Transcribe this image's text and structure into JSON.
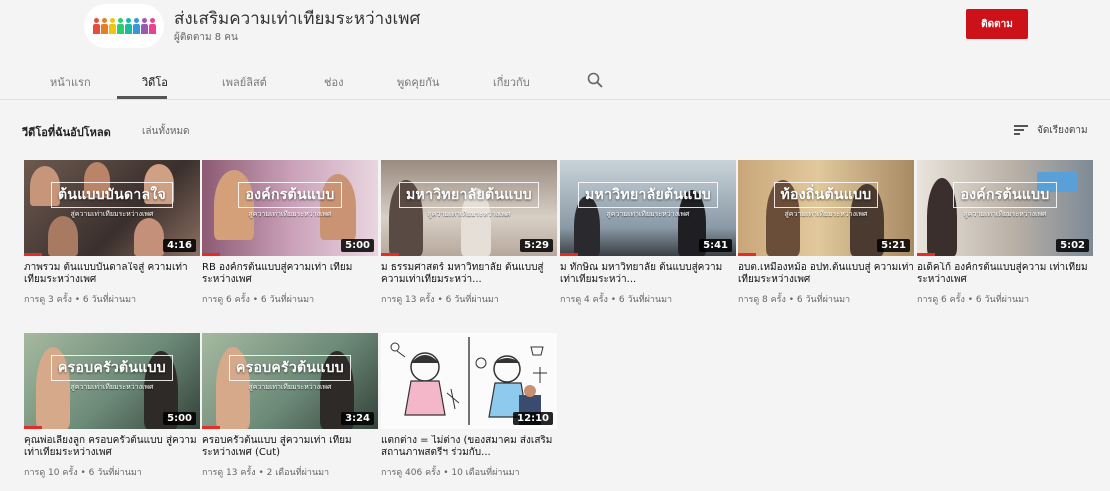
{
  "channel": {
    "name": "ส่งเสริมความเท่าเทียมระหว่างเพศ",
    "subscribers": "ผู้ติดตาม 8 คน",
    "subscribe_label": "ติดตาม",
    "logo_colors": [
      "#e74c3c",
      "#e67e22",
      "#f1c40f",
      "#2ecc71",
      "#1abc9c",
      "#3498db",
      "#9b59b6",
      "#e84393"
    ]
  },
  "tabs": [
    {
      "label": "หน้าแรก",
      "active": false
    },
    {
      "label": "วิดีโอ",
      "active": true
    },
    {
      "label": "เพลย์ลิสต์",
      "active": false
    },
    {
      "label": "ช่อง",
      "active": false
    },
    {
      "label": "พูดคุยกัน",
      "active": false
    },
    {
      "label": "เกี่ยวกับ",
      "active": false
    }
  ],
  "section": {
    "title": "วีดีโอที่ฉันอัปโหลด",
    "play_all": "เล่นทั้งหมด",
    "sort_label": "จัดเรียงตาม"
  },
  "videos": [
    {
      "title": "ภาพรวม ต้นแบบบันดาลใจสู่ ความเท่าเทียมระหว่างเพศ",
      "meta": "การดู 3 ครั้ง • 6 วันที่ผ่านมา",
      "duration": "4:16",
      "overlay": "ต้นแบบบันดาลใจ",
      "overlay_sub": "สู่ความเท่าเทียมระหว่างเพศ"
    },
    {
      "title": "RB องค์กรต้นแบบสู่ความเท่า เทียมระหว่างเพศ",
      "meta": "การดู 6 ครั้ง • 6 วันที่ผ่านมา",
      "duration": "5:00",
      "overlay": "องค์กรต้นแบบ",
      "overlay_sub": "สู่ความเท่าเทียมระหว่างเพศ"
    },
    {
      "title": "ม ธรรมศาสตร์ มหาวิทยาลัย ต้นแบบสู่ความเท่าเทียมระหว่า...",
      "meta": "การดู 13 ครั้ง • 6 วันที่ผ่านมา",
      "duration": "5:29",
      "overlay": "มหาวิทยาลัยต้นแบบ",
      "overlay_sub": "สู่ความเท่าเทียมระหว่างเพศ"
    },
    {
      "title": "ม ทักษิณ มหาวิทยาลัย ต้นแบบสู่ความเท่าเทียมระหว่า...",
      "meta": "การดู 4 ครั้ง • 6 วันที่ผ่านมา",
      "duration": "5:41",
      "overlay": "มหาวิทยาลัยต้นแบบ",
      "overlay_sub": "สู่ความเท่าเทียมระหว่างเพศ"
    },
    {
      "title": "อบต.เหมืองหม้อ อปท.ต้นแบบสู่ ความเท่าเทียมระหว่างเพศ",
      "meta": "การดู 8 ครั้ง • 6 วันที่ผ่านมา",
      "duration": "5:21",
      "overlay": "ท้องถิ่นต้นแบบ",
      "overlay_sub": "สู่ความเท่าเทียมระหว่างเพศ"
    },
    {
      "title": "อเด็คโก้ องค์กรต้นแบบสู่ความ เท่าเทียมระหว่างเพศ",
      "meta": "การดู 6 ครั้ง • 6 วันที่ผ่านมา",
      "duration": "5:02",
      "overlay": "องค์กรต้นแบบ",
      "overlay_sub": "สู่ความเท่าเทียมระหว่างเพศ"
    },
    {
      "title": "คุณพ่อเลี้ยงลูก ครอบครัวต้นแบบ สู่ความเท่าเทียมระหว่างเพศ",
      "meta": "การดู 10 ครั้ง • 6 วันที่ผ่านมา",
      "duration": "5:00",
      "overlay": "ครอบครัวต้นแบบ",
      "overlay_sub": "สู่ความเท่าเทียมระหว่างเพศ"
    },
    {
      "title": "ครอบครัวต้นแบบ สู่ความเท่า เทียมระหว่างเพศ (Cut)",
      "meta": "การดู 13 ครั้ง • 2 เดือนที่ผ่านมา",
      "duration": "3:24",
      "overlay": "ครอบครัวต้นแบบ",
      "overlay_sub": "สู่ความเท่าเทียมระหว่างเพศ"
    },
    {
      "title": "แตกต่าง = ไม่ต่าง (ของสมาคม ส่งเสริมสถานภาพสตรีฯ ร่วมกับ...",
      "meta": "การดู 406 ครั้ง • 10 เดือนที่ผ่านมา",
      "duration": "12:10",
      "overlay": "",
      "overlay_sub": ""
    }
  ],
  "colors": {
    "subscribe_red": "#cc1218",
    "progress_red": "#e52d27",
    "background": "#f4f4f4"
  }
}
